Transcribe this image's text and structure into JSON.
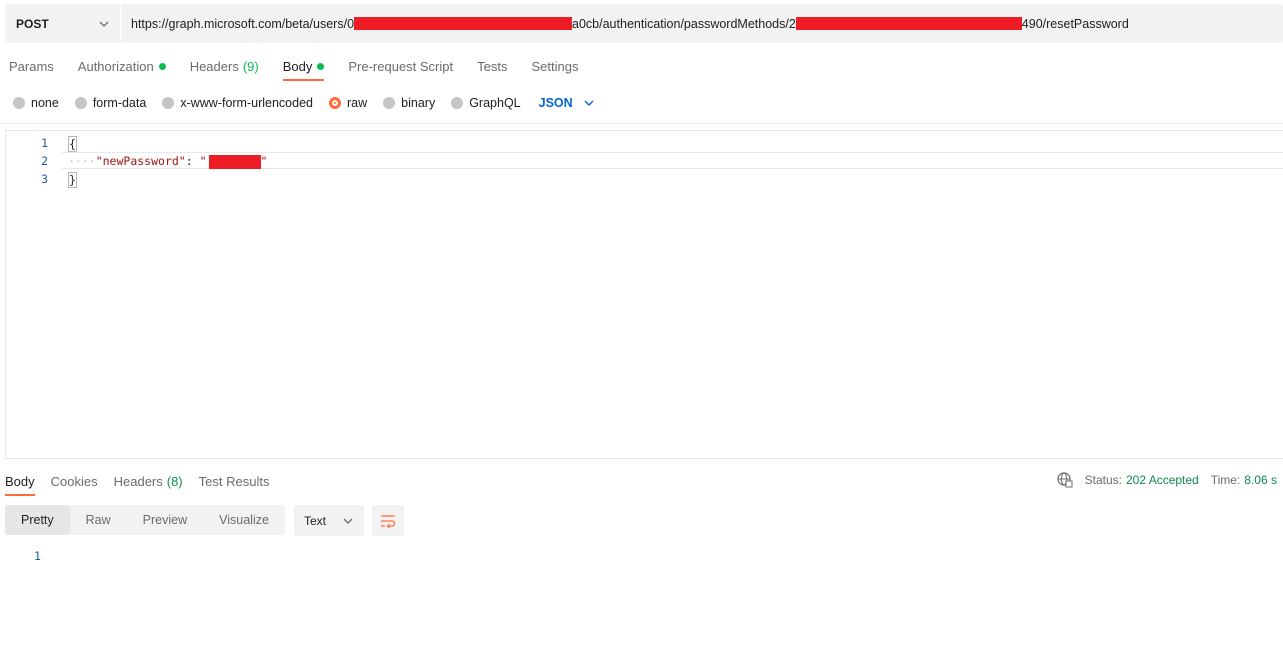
{
  "request": {
    "method": "POST",
    "url_part1": "https://graph.microsoft.com/beta/users/0",
    "url_part2": "a0cb/authentication/passwordMethods/2",
    "url_part3": "490/resetPassword"
  },
  "request_tabs": [
    {
      "label": "Params"
    },
    {
      "label": "Authorization",
      "indicator": "dot"
    },
    {
      "label": "Headers",
      "count": "(9)"
    },
    {
      "label": "Body",
      "indicator": "dot"
    },
    {
      "label": "Pre-request Script"
    },
    {
      "label": "Tests"
    },
    {
      "label": "Settings"
    }
  ],
  "body_types": [
    "none",
    "form-data",
    "x-www-form-urlencoded",
    "raw",
    "binary",
    "GraphQL"
  ],
  "body_selected": "raw",
  "language": "JSON",
  "editor": {
    "line_numbers": [
      "1",
      "2",
      "3"
    ],
    "open_brace": "{",
    "indent": "····",
    "key": "\"newPassword\"",
    "colon": ": ",
    "quote_open": "\"",
    "quote_close": "\"",
    "close_brace": "}"
  },
  "response_tabs": [
    {
      "label": "Body"
    },
    {
      "label": "Cookies"
    },
    {
      "label": "Headers",
      "count": "(8)"
    },
    {
      "label": "Test Results"
    }
  ],
  "status": {
    "status_label": "Status:",
    "status_value": "202 Accepted",
    "time_label": "Time:",
    "time_value": "8.06 s"
  },
  "view_modes": [
    "Pretty",
    "Raw",
    "Preview",
    "Visualize"
  ],
  "format": "Text",
  "response_line_numbers": [
    "1"
  ],
  "colors": {
    "accent": "#ff6c37",
    "indicator": "#0cbb52",
    "link": "#0265d2",
    "redaction": "#ee1c24"
  }
}
